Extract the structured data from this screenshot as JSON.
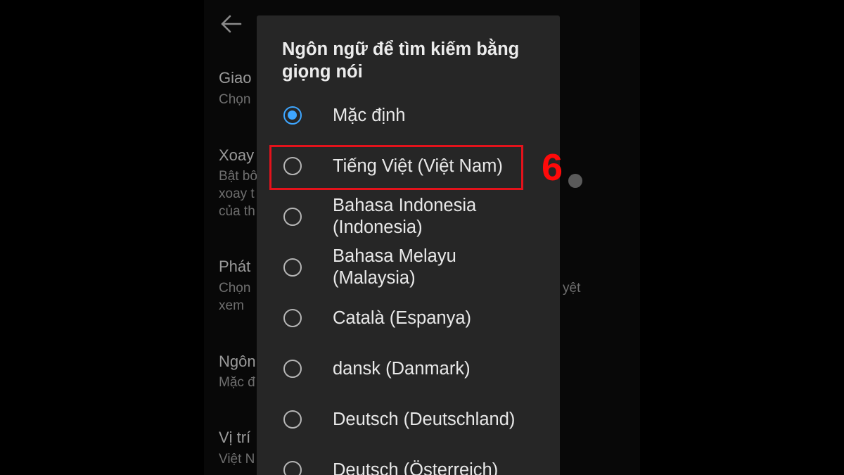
{
  "background_settings": {
    "items": [
      {
        "title": "Giao",
        "subtitle_lines": [
          "Chọn"
        ]
      },
      {
        "title": "Xoay",
        "subtitle_lines": [
          "Bật bô",
          "xoay t",
          "của th"
        ]
      },
      {
        "title": "Phát",
        "subtitle_lines": [
          "Chọn",
          "xem"
        ],
        "subtitle_right": "yệt"
      },
      {
        "title": "Ngôn",
        "subtitle_lines": [
          "Mặc đ"
        ]
      },
      {
        "title": "Vị trí",
        "subtitle_lines": [
          "Việt N"
        ]
      }
    ]
  },
  "dialog": {
    "title": "Ngôn ngữ để tìm kiếm bằng giọng nói",
    "selected_index": 0,
    "options": [
      {
        "label": "Mặc định",
        "checked": true
      },
      {
        "label": "Tiếng Việt (Việt Nam)",
        "checked": false
      },
      {
        "label": "Bahasa Indonesia (Indonesia)",
        "checked": false
      },
      {
        "label": "Bahasa Melayu (Malaysia)",
        "checked": false
      },
      {
        "label": "Català (Espanya)",
        "checked": false
      },
      {
        "label": "dansk (Danmark)",
        "checked": false
      },
      {
        "label": "Deutsch (Deutschland)",
        "checked": false
      },
      {
        "label": "Deutsch (Österreich)",
        "checked": false
      }
    ]
  },
  "annotation": {
    "step_number": "6",
    "highlighted_option_index": 1,
    "color": "#e4121b"
  },
  "colors": {
    "accent": "#3ea6ff",
    "dialog_background": "#262626",
    "screen_background": "#000000"
  },
  "icons": {
    "back": "arrow-left-icon",
    "radio_selected": "radio-checked-icon",
    "radio_unselected": "radio-unchecked-icon"
  }
}
